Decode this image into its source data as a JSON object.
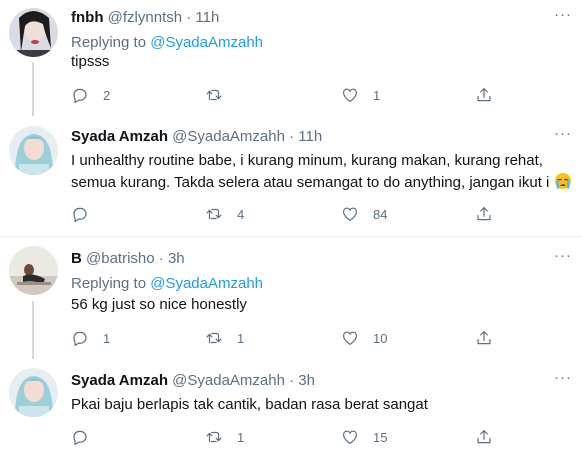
{
  "tweets": [
    {
      "name": "fnbh",
      "handle": "@fzlynntsh",
      "sep": "·",
      "time": "11h",
      "replying_prefix": "Replying to",
      "replying_to": "@SyadaAmzahh",
      "text": "tipsss",
      "reply_count": "2",
      "retweet_count": "",
      "like_count": "1"
    },
    {
      "name": "Syada Amzah",
      "handle": "@SyadaAmzahh",
      "sep": "·",
      "time": "11h",
      "text_line1": "I unhealthy routine babe, i kurang minum, kurang makan, kurang rehat,",
      "text_line2": "semua kurang. Takda selera atau semangat to do anything, jangan ikut i",
      "emoji": "crying-face",
      "reply_count": "",
      "retweet_count": "4",
      "like_count": "84"
    },
    {
      "name": "B",
      "handle": "@batrisho",
      "sep": "·",
      "time": "3h",
      "replying_prefix": "Replying to",
      "replying_to": "@SyadaAmzahh",
      "text": "56 kg just so nice honestly",
      "reply_count": "1",
      "retweet_count": "1",
      "like_count": "10"
    },
    {
      "name": "Syada Amzah",
      "handle": "@SyadaAmzahh",
      "sep": "·",
      "time": "3h",
      "text": "Pkai baju berlapis tak cantik, badan rasa berat sangat",
      "reply_count": "",
      "retweet_count": "1",
      "like_count": "15"
    }
  ],
  "more_label": "···",
  "colors": {
    "accent": "#1d9bf0",
    "muted": "#5b7083",
    "text": "#0f1419",
    "thread_line": "#cfd9de"
  }
}
